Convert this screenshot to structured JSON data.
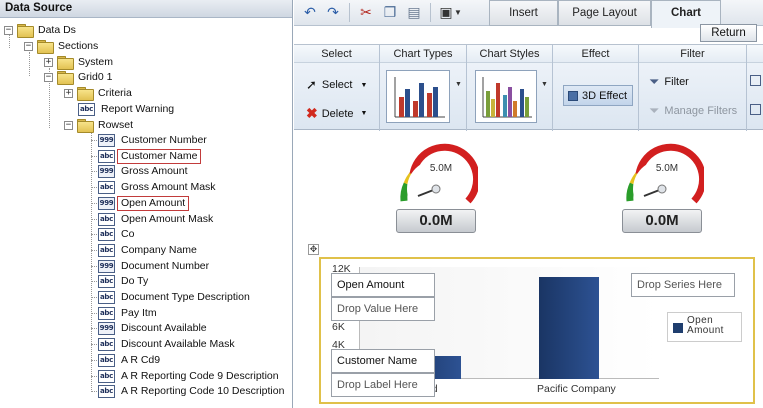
{
  "left_panel": {
    "title": "Data Source",
    "tree": {
      "root": "Data Ds",
      "sections": "Sections",
      "system": "System",
      "grid": "Grid0 1",
      "criteria": "Criteria",
      "report_warning": "Report Warning",
      "rowset": "Rowset",
      "fields": [
        {
          "label": "Customer Number",
          "type": "999",
          "highlighted": false
        },
        {
          "label": "Customer Name",
          "type": "abc",
          "highlighted": true
        },
        {
          "label": "Gross Amount",
          "type": "999",
          "highlighted": false
        },
        {
          "label": "Gross Amount Mask",
          "type": "abc",
          "highlighted": false
        },
        {
          "label": "Open Amount",
          "type": "999",
          "highlighted": true
        },
        {
          "label": "Open Amount Mask",
          "type": "abc",
          "highlighted": false
        },
        {
          "label": "Co",
          "type": "abc",
          "highlighted": false
        },
        {
          "label": "Company Name",
          "type": "abc",
          "highlighted": false
        },
        {
          "label": "Document Number",
          "type": "999",
          "highlighted": false
        },
        {
          "label": "Do Ty",
          "type": "abc",
          "highlighted": false
        },
        {
          "label": "Document Type Description",
          "type": "abc",
          "highlighted": false
        },
        {
          "label": "Pay Itm",
          "type": "abc",
          "highlighted": false
        },
        {
          "label": "Discount Available",
          "type": "999",
          "highlighted": false
        },
        {
          "label": "Discount Available Mask",
          "type": "abc",
          "highlighted": false
        },
        {
          "label": "A R Cd9",
          "type": "abc",
          "highlighted": false
        },
        {
          "label": "A R Reporting Code 9 Description",
          "type": "abc",
          "highlighted": false
        },
        {
          "label": "A R Reporting Code 10 Description",
          "type": "abc",
          "highlighted": false
        }
      ]
    }
  },
  "tabs": [
    {
      "label": "Insert",
      "active": false
    },
    {
      "label": "Page Layout",
      "active": false
    },
    {
      "label": "Chart",
      "active": true
    }
  ],
  "return_label": "Return",
  "ribbon": {
    "select_group": {
      "title": "Select",
      "select_label": "Select",
      "delete_label": "Delete"
    },
    "chart_types_group": {
      "title": "Chart Types"
    },
    "chart_styles_group": {
      "title": "Chart Styles"
    },
    "effect_group": {
      "title": "Effect",
      "effect_label": "3D Effect"
    },
    "filter_group": {
      "title": "Filter",
      "filter_label": "Filter",
      "manage_filters_label": "Manage Filters"
    }
  },
  "gauges": [
    {
      "max_label": "5.0M",
      "value_label": "0.0M"
    },
    {
      "max_label": "5.0M",
      "value_label": "0.0M"
    }
  ],
  "chart": {
    "value_field": "Open Amount",
    "value_drop_placeholder": "Drop Value Here",
    "label_field": "Customer Name",
    "label_drop_placeholder": "Drop Label Here",
    "series_drop_placeholder": "Drop Series Here",
    "legend_label": "Open Amount",
    "y_tick_labels": [
      "12K",
      "1",
      "6K",
      "4K"
    ],
    "x_category_labels": [
      "Ltd",
      "Pacific Company"
    ],
    "bar_color": "#1f3e6e"
  }
}
